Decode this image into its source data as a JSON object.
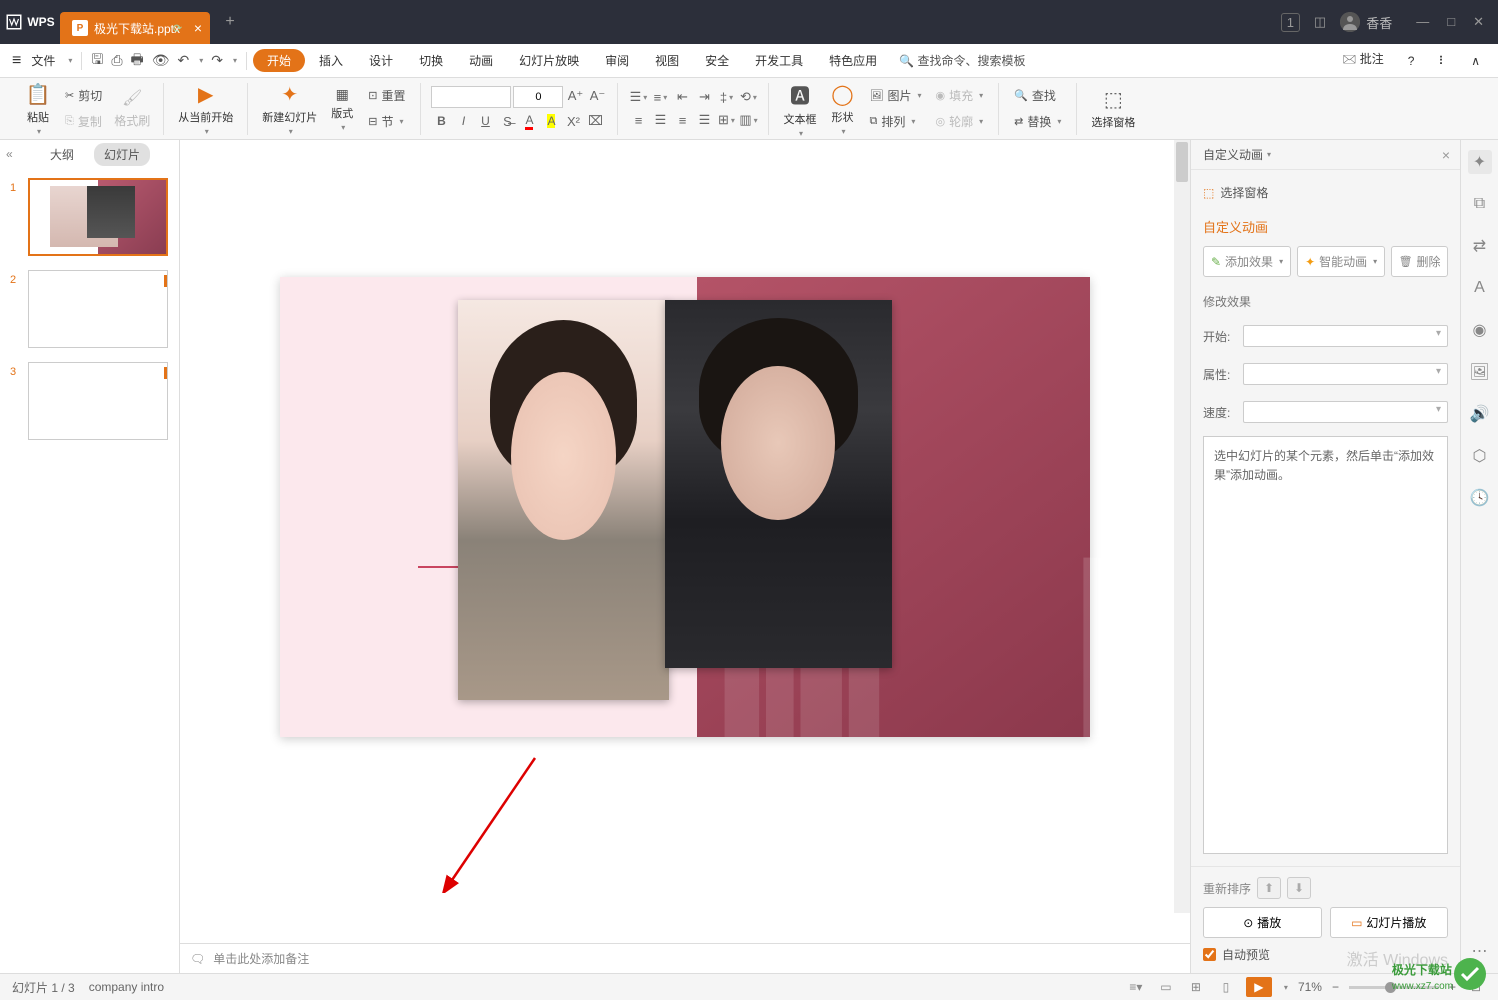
{
  "titlebar": {
    "app": "WPS",
    "tab_filename": "极光下载站.pptx",
    "user": "香香",
    "badge": "1"
  },
  "menubar": {
    "file": "文件",
    "tabs": [
      "开始",
      "插入",
      "设计",
      "切换",
      "动画",
      "幻灯片放映",
      "审阅",
      "视图",
      "安全",
      "开发工具",
      "特色应用"
    ],
    "search": "查找命令、搜索模板",
    "comment": "批注"
  },
  "ribbon": {
    "paste": "粘贴",
    "cut": "剪切",
    "copy": "复制",
    "format_painter": "格式刷",
    "from_current": "从当前开始",
    "new_slide": "新建幻灯片",
    "layout": "版式",
    "section": "节",
    "reset": "重置",
    "font_size": "0",
    "textbox": "文本框",
    "shape": "形状",
    "arrange": "排列",
    "picture": "图片",
    "fill": "填充",
    "outline": "轮廓",
    "find": "查找",
    "replace": "替换",
    "select_pane": "选择窗格"
  },
  "side": {
    "outline": "大纲",
    "slides": "幻灯片",
    "thumbs": [
      "1",
      "2",
      "3"
    ]
  },
  "notes": {
    "placeholder": "单击此处添加备注"
  },
  "anim": {
    "title": "自定义动画",
    "select_pane": "选择窗格",
    "custom": "自定义动画",
    "add_effect": "添加效果",
    "smart": "智能动画",
    "delete": "删除",
    "modify": "修改效果",
    "start": "开始:",
    "property": "属性:",
    "speed": "速度:",
    "desc": "选中幻灯片的某个元素，然后单击“添加效果”添加动画。",
    "reorder": "重新排序",
    "play": "播放",
    "slideshow": "幻灯片播放",
    "auto_preview": "自动预览"
  },
  "status": {
    "slide": "幻灯片 1 / 3",
    "template": "company intro",
    "zoom": "71%"
  },
  "watermark": {
    "line1": "激活 Windows",
    "line2": "极光下载站",
    "url": "www.xz7.com"
  }
}
